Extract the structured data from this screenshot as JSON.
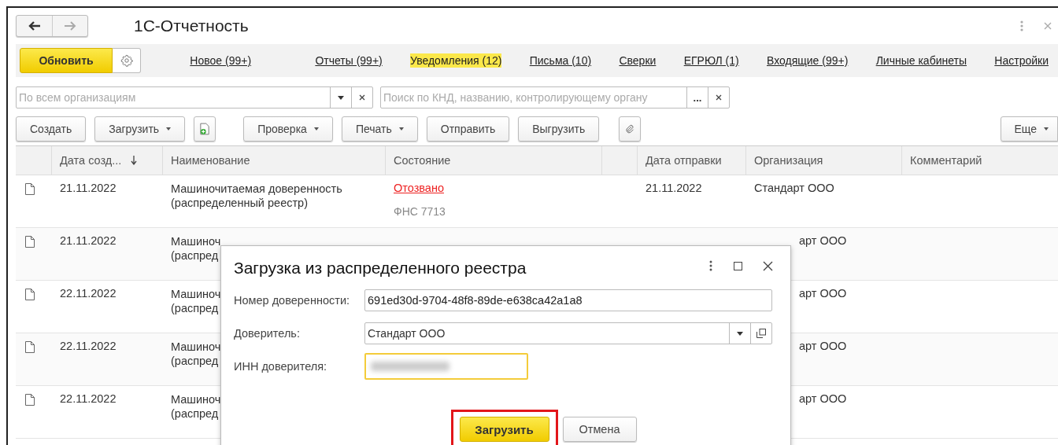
{
  "window": {
    "title": "1С-Отчетность"
  },
  "refresh_button": "Обновить",
  "sections": [
    {
      "label": "Новое (99+)",
      "selected": false
    },
    {
      "label": "Отчеты (99+)",
      "selected": false
    },
    {
      "label": "Уведомления (12)",
      "selected": true
    },
    {
      "label": "Письма (10)",
      "selected": false
    },
    {
      "label": "Сверки",
      "selected": false
    },
    {
      "label": "ЕГРЮЛ (1)",
      "selected": false
    },
    {
      "label": "Входящие (99+)",
      "selected": false
    },
    {
      "label": "Личные кабинеты",
      "selected": false
    },
    {
      "label": "Настройки",
      "selected": false
    }
  ],
  "org_filter": {
    "placeholder": "По всем организациям"
  },
  "search": {
    "placeholder": "Поиск по КНД, названию, контролирующему органу",
    "more": "..."
  },
  "toolbar": [
    {
      "kind": "button",
      "label": "Создать"
    },
    {
      "kind": "dropdown",
      "label": "Загрузить"
    },
    {
      "kind": "add-icon"
    },
    {
      "kind": "dropdown",
      "label": "Проверка"
    },
    {
      "kind": "dropdown",
      "label": "Печать"
    },
    {
      "kind": "button",
      "label": "Отправить"
    },
    {
      "kind": "button",
      "label": "Выгрузить"
    },
    {
      "kind": "clip-icon"
    }
  ],
  "more_button": "Еще",
  "table": {
    "columns": [
      {
        "label": "Дата созд...",
        "sorted": true
      },
      {
        "label": "Наименование"
      },
      {
        "label": "Состояние"
      },
      {
        "label": "Дата отправки"
      },
      {
        "label": "Организация"
      },
      {
        "label": "Комментарий"
      }
    ],
    "rows": [
      {
        "date": "21.11.2022",
        "name": "Машиночитаемая доверенность\n(распределенный реестр)",
        "status": "Отозвано",
        "revoked": true,
        "authority": "ФНС 7713",
        "sent": "21.11.2022",
        "org": "Стандарт ООО",
        "org_clipped": false
      },
      {
        "date": "21.11.2022",
        "name": "Машиноч\n(распред",
        "org": "арт ООО",
        "org_clipped": true
      },
      {
        "date": "22.11.2022",
        "name": "Машиноч\n(распред",
        "org": "арт ООО",
        "org_clipped": true
      },
      {
        "date": "22.11.2022",
        "name": "Машиноч\n(распред",
        "org": "арт ООО",
        "org_clipped": true
      },
      {
        "date": "22.11.2022",
        "name": "Машиноч\n(распред",
        "org": "арт ООО",
        "org_clipped": true
      }
    ]
  },
  "dialog": {
    "title": "Загрузка из распределенного реестра",
    "fields": [
      {
        "kind": "text",
        "label": "Номер доверенности:",
        "value": "691ed30d-9704-48f8-89de-e638ca42a1a8"
      },
      {
        "kind": "select",
        "label": "Доверитель:",
        "value": "Стандарт ООО"
      },
      {
        "kind": "redacted",
        "label": "ИНН доверителя:",
        "focused": true
      }
    ],
    "buttons": [
      {
        "kind": "primary",
        "label": "Загрузить",
        "highlighted": true
      },
      {
        "kind": "default",
        "label": "Отмена",
        "highlighted": false
      }
    ]
  }
}
